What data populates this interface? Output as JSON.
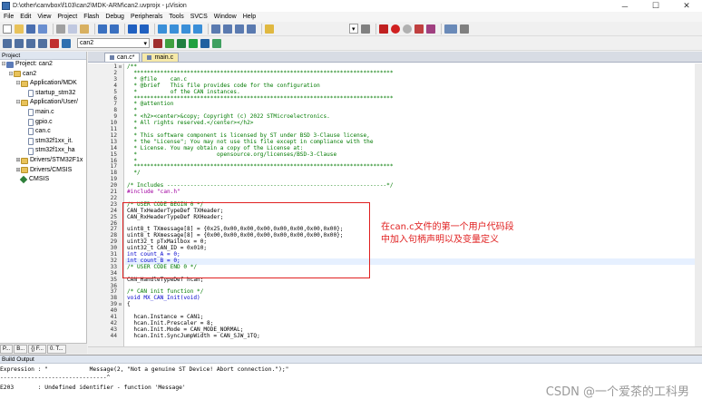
{
  "window": {
    "title": "D:\\other\\canvbox\\f103\\can2\\MDK-ARM\\can2.uvprojx - µVision",
    "min_glyph": "─",
    "max_glyph": "☐",
    "close_glyph": "✕"
  },
  "menu": [
    "File",
    "Edit",
    "View",
    "Project",
    "Flash",
    "Debug",
    "Peripherals",
    "Tools",
    "SVCS",
    "Window",
    "Help"
  ],
  "toolbar": {
    "target_value": "can2"
  },
  "project": {
    "panel_title": "Project",
    "tree": [
      {
        "label": "Project: can2",
        "level": 0,
        "kind": "proj",
        "exp": "⊟"
      },
      {
        "label": "can2",
        "level": 1,
        "kind": "folder",
        "exp": "⊟"
      },
      {
        "label": "Application/MDK",
        "level": 2,
        "kind": "folder",
        "exp": "⊟"
      },
      {
        "label": "startup_stm32",
        "level": 3,
        "kind": "file",
        "exp": ""
      },
      {
        "label": "Application/User/",
        "level": 2,
        "kind": "folder",
        "exp": "⊟"
      },
      {
        "label": "main.c",
        "level": 3,
        "kind": "file",
        "exp": ""
      },
      {
        "label": "gpio.c",
        "level": 3,
        "kind": "file",
        "exp": ""
      },
      {
        "label": "can.c",
        "level": 3,
        "kind": "file",
        "exp": ""
      },
      {
        "label": "stm32f1xx_it.",
        "level": 3,
        "kind": "file",
        "exp": ""
      },
      {
        "label": "stm32f1xx_ha",
        "level": 3,
        "kind": "file",
        "exp": ""
      },
      {
        "label": "Drivers/STM32F1x",
        "level": 2,
        "kind": "folder",
        "exp": "⊞"
      },
      {
        "label": "Drivers/CMSIS",
        "level": 2,
        "kind": "folder",
        "exp": "⊞"
      },
      {
        "label": "CMSIS",
        "level": 1,
        "kind": "diamond",
        "exp": ""
      }
    ],
    "tabs": [
      "P...",
      "B...",
      "{} F...",
      "0. T..."
    ]
  },
  "editor": {
    "tabs": [
      {
        "label": "can.c*",
        "active": true
      },
      {
        "label": "main.c",
        "active": false
      }
    ],
    "lines": [
      {
        "n": "1",
        "fold": "⊟",
        "cls": "cm",
        "text": "/**"
      },
      {
        "n": "2",
        "fold": "",
        "cls": "cm",
        "text": "  ******************************************************************************"
      },
      {
        "n": "3",
        "fold": "",
        "cls": "cm",
        "text": "  * @file    can.c"
      },
      {
        "n": "4",
        "fold": "",
        "cls": "cm",
        "text": "  * @brief   This file provides code for the configuration"
      },
      {
        "n": "5",
        "fold": "",
        "cls": "cm",
        "text": "  *          of the CAN instances."
      },
      {
        "n": "6",
        "fold": "",
        "cls": "cm",
        "text": "  ******************************************************************************"
      },
      {
        "n": "7",
        "fold": "",
        "cls": "cm",
        "text": "  * @attention"
      },
      {
        "n": "8",
        "fold": "",
        "cls": "cm",
        "text": "  *"
      },
      {
        "n": "9",
        "fold": "",
        "cls": "cm",
        "text": "  * <h2><center>&copy; Copyright (c) 2022 STMicroelectronics."
      },
      {
        "n": "10",
        "fold": "",
        "cls": "cm",
        "text": "  * All rights reserved.</center></h2>"
      },
      {
        "n": "11",
        "fold": "",
        "cls": "cm",
        "text": "  *"
      },
      {
        "n": "12",
        "fold": "",
        "cls": "cm",
        "text": "  * This software component is licensed by ST under BSD 3-Clause license,"
      },
      {
        "n": "13",
        "fold": "",
        "cls": "cm",
        "text": "  * the \"License\"; You may not use this file except in compliance with the"
      },
      {
        "n": "14",
        "fold": "",
        "cls": "cm",
        "text": "  * License. You may obtain a copy of the License at:"
      },
      {
        "n": "15",
        "fold": "",
        "cls": "cm",
        "text": "  *                        opensource.org/licenses/BSD-3-Clause"
      },
      {
        "n": "16",
        "fold": "",
        "cls": "cm",
        "text": "  *"
      },
      {
        "n": "17",
        "fold": "",
        "cls": "cm",
        "text": "  ******************************************************************************"
      },
      {
        "n": "18",
        "fold": "",
        "cls": "cm",
        "text": "  */"
      },
      {
        "n": "19",
        "fold": "",
        "cls": "tx",
        "text": ""
      },
      {
        "n": "20",
        "fold": "",
        "cls": "cm",
        "text": "/* Includes ------------------------------------------------------------------*/"
      },
      {
        "n": "21",
        "fold": "",
        "cls": "pp",
        "text": "#include \"can.h\""
      },
      {
        "n": "22",
        "fold": "",
        "cls": "tx",
        "text": ""
      },
      {
        "n": "23",
        "fold": "",
        "cls": "cm",
        "text": "/* USER CODE BEGIN 0 */"
      },
      {
        "n": "24",
        "fold": "",
        "cls": "tx",
        "text": "CAN_TxHeaderTypeDef TXHeader;"
      },
      {
        "n": "25",
        "fold": "",
        "cls": "tx",
        "text": "CAN_RxHeaderTypeDef RXHeader;"
      },
      {
        "n": "26",
        "fold": "",
        "cls": "tx",
        "text": ""
      },
      {
        "n": "27",
        "fold": "",
        "cls": "tx",
        "text": "uint8_t TXmessage[8] = {0x25,0x00,0x00,0x00,0x00,0x00,0x00,0x00};"
      },
      {
        "n": "28",
        "fold": "",
        "cls": "tx",
        "text": "uint8_t RXmessage[8] = {0x00,0x00,0x00,0x00,0x00,0x00,0x00,0x00};"
      },
      {
        "n": "29",
        "fold": "",
        "cls": "tx",
        "text": "uint32_t pTxMailbox = 0;"
      },
      {
        "n": "30",
        "fold": "",
        "cls": "tx",
        "text": "uint32_t CAN_ID = 0x010;"
      },
      {
        "n": "31",
        "fold": "",
        "cls": "kw",
        "text": "int count_A = 0;"
      },
      {
        "n": "32",
        "fold": "",
        "cls": "kw",
        "text": "int count_B = 0;"
      },
      {
        "n": "33",
        "fold": "",
        "cls": "cm",
        "text": "/* USER CODE END 0 */"
      },
      {
        "n": "34",
        "fold": "",
        "cls": "tx",
        "text": ""
      },
      {
        "n": "35",
        "fold": "",
        "cls": "tx",
        "text": "CAN_HandleTypeDef hcan;"
      },
      {
        "n": "36",
        "fold": "",
        "cls": "tx",
        "text": ""
      },
      {
        "n": "37",
        "fold": "",
        "cls": "cm",
        "text": "/* CAN init function */"
      },
      {
        "n": "38",
        "fold": "",
        "cls": "kw",
        "text": "void MX_CAN_Init(void)"
      },
      {
        "n": "39",
        "fold": "⊟",
        "cls": "tx",
        "text": "{"
      },
      {
        "n": "40",
        "fold": "",
        "cls": "tx",
        "text": ""
      },
      {
        "n": "41",
        "fold": "",
        "cls": "tx",
        "text": "  hcan.Instance = CAN1;"
      },
      {
        "n": "42",
        "fold": "",
        "cls": "tx",
        "text": "  hcan.Init.Prescaler = 8;"
      },
      {
        "n": "43",
        "fold": "",
        "cls": "tx",
        "text": "  hcan.Init.Mode = CAN_MODE_NORMAL;"
      },
      {
        "n": "44",
        "fold": "",
        "cls": "tx",
        "text": "  hcan.Init.SyncJumpWidth = CAN_SJW_1TQ;"
      }
    ],
    "annotation": [
      "在can.c文件的第一个用户代码段",
      "中加入句柄声明以及变量定义"
    ]
  },
  "build": {
    "title": "Build Output",
    "lines": [
      "Expression : \"            Message(2, \"Not a genuine ST Device! Abort connection.\");\"",
      "-------------------------------^",
      "E203       : Undefined identifier - function 'Message'"
    ]
  },
  "watermark": "CSDN @一个爱茶的工科男",
  "colors": {
    "highlight": "#e02020",
    "comment": "#007a00",
    "keyword": "#0000cc",
    "preprocessor": "#a000a0"
  }
}
